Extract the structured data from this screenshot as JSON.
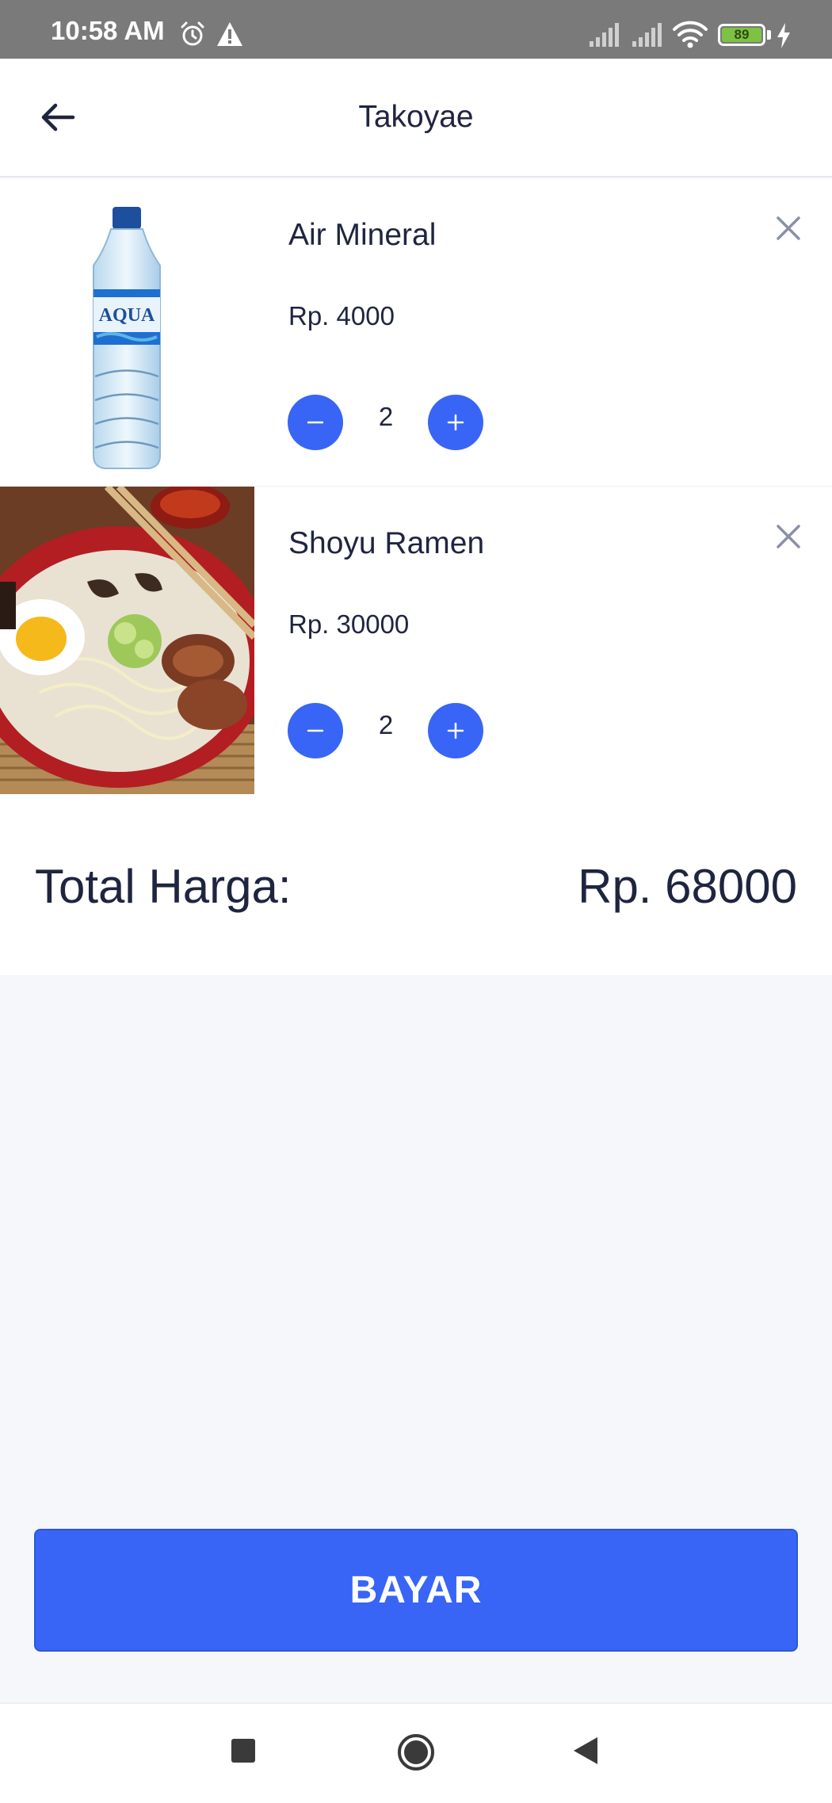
{
  "status_bar": {
    "time": "10:58 AM",
    "battery": "89",
    "icons": [
      "alarm-icon",
      "warning-icon",
      "signal-icon",
      "signal-icon",
      "wifi-icon",
      "battery-icon",
      "charging-icon"
    ]
  },
  "app_bar": {
    "title": "Takoyae",
    "back_icon": "arrow-left-icon"
  },
  "cart": {
    "items": [
      {
        "name": "Air Mineral",
        "price": "Rp. 4000",
        "quantity": "2",
        "image": "water-bottle-photo"
      },
      {
        "name": "Shoyu Ramen",
        "price": "Rp. 30000",
        "quantity": "2",
        "image": "ramen-bowl-photo"
      }
    ]
  },
  "summary": {
    "total_label": "Total Harga:",
    "total_value": "Rp. 68000"
  },
  "actions": {
    "pay_label": "BAYAR"
  },
  "nav_bar": {
    "icons": [
      "recent-apps-icon",
      "home-icon",
      "back-icon"
    ]
  },
  "colors": {
    "accent": "#3865f5",
    "text": "#1f2540",
    "background": "#f6f7fb",
    "status_bar": "#7a7a7a"
  }
}
